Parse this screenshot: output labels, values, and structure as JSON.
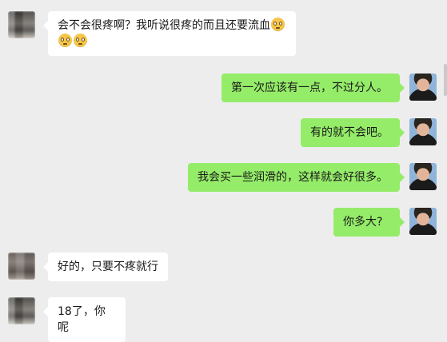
{
  "messages": [
    {
      "side": "left",
      "text": "会不会很疼啊？我听说很疼的而且还要流血",
      "emoji_line": true,
      "emoji_icon": "woozy-face-icon"
    },
    {
      "side": "right",
      "text": "第一次应该有一点，不过分人。"
    },
    {
      "side": "right",
      "text": "有的就不会吧。"
    },
    {
      "side": "right",
      "text": "我会买一些润滑的，这样就会好很多。"
    },
    {
      "side": "right",
      "text": "你多大?"
    },
    {
      "side": "left",
      "text": "好的，只要不疼就行"
    },
    {
      "side": "left",
      "text": "18了，你呢"
    }
  ],
  "colors": {
    "background": "#ededed",
    "bubble_self": "#95ec69",
    "bubble_other": "#ffffff",
    "text": "#191919"
  }
}
